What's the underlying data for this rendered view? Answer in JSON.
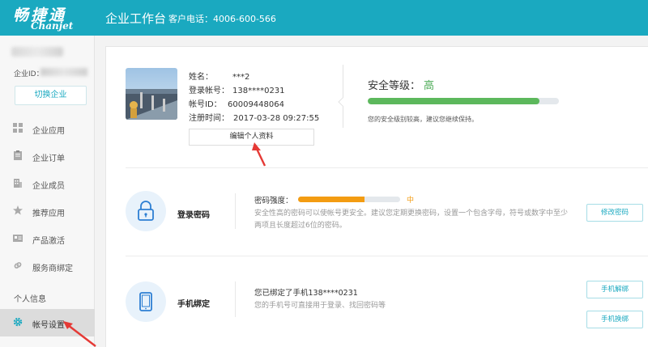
{
  "header": {
    "logo_cn": "畅捷通",
    "logo_en": "Chanjet",
    "title": "企业工作台",
    "phone": "客户电话：4006-600-566"
  },
  "sidebar": {
    "company_id_label": "企业ID：",
    "switch_label": "切换企业",
    "items": [
      {
        "label": "企业应用",
        "icon": "grid-icon"
      },
      {
        "label": "企业订单",
        "icon": "clipboard-icon"
      },
      {
        "label": "企业成员",
        "icon": "building-icon"
      },
      {
        "label": "推荐应用",
        "icon": "star-icon"
      },
      {
        "label": "产品激活",
        "icon": "id-card-icon"
      },
      {
        "label": "服务商绑定",
        "icon": "link-icon"
      }
    ],
    "section_label": "个人信息",
    "active_item": {
      "label": "帐号设置",
      "icon": "gear-icon"
    }
  },
  "profile": {
    "name_label": "姓名：",
    "name_value": "***2",
    "login_label": "登录帐号：",
    "login_value": "138****0231",
    "account_id_label": "帐号ID：",
    "account_id_value": "60009448064",
    "register_label": "注册时间：",
    "register_value": "2017-03-28 09:27:55",
    "edit_button": "编辑个人资料"
  },
  "security": {
    "title": "安全等级：",
    "level": "高",
    "progress": 0.9,
    "note": "您的安全级别较高，建议您继续保持。"
  },
  "password": {
    "title": "登录密码",
    "strength_label": "密码强度：",
    "strength_level": "中",
    "strength_progress": 0.65,
    "desc": "安全性高的密码可以使帐号更安全。建议您定期更换密码，设置一个包含字母，符号或数字中至少两项且长度超过6位的密码。",
    "button": "修改密码"
  },
  "phone": {
    "title": "手机绑定",
    "bound_text": "您已绑定了手机138****0231",
    "desc": "您的手机号可直接用于登录、找回密码等",
    "unbind_button": "手机解绑",
    "change_button": "手机换绑"
  },
  "colors": {
    "header": "#1aa9c0",
    "security_fill": "#5cb85c",
    "password_fill": "#f39c12",
    "annotation_arrow": "#e53935"
  }
}
